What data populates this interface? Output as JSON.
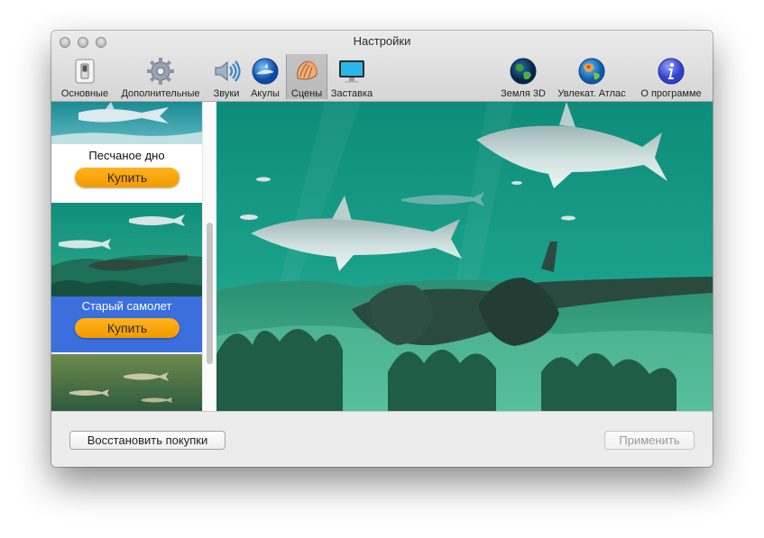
{
  "window": {
    "title": "Настройки"
  },
  "toolbar": {
    "items": [
      {
        "label": "Основные",
        "icon": "switch-icon"
      },
      {
        "label": "Дополнительные",
        "icon": "gear-icon"
      },
      {
        "label": "Звуки",
        "icon": "speaker-icon"
      },
      {
        "label": "Акулы",
        "icon": "shark-globe-icon"
      },
      {
        "label": "Сцены",
        "icon": "seashell-icon",
        "selected": true
      },
      {
        "label": "Заставка",
        "icon": "monitor-icon"
      },
      {
        "label": "Земля 3D",
        "icon": "earth-icon"
      },
      {
        "label": "Увлекат. Атлас",
        "icon": "atlas-globe-icon"
      },
      {
        "label": "О программе",
        "icon": "info-icon"
      }
    ]
  },
  "scenes": [
    {
      "name": "Песчаное дно",
      "buy_label": "Купить",
      "selected": false
    },
    {
      "name": "Старый самолет",
      "buy_label": "Купить",
      "selected": true
    }
  ],
  "footer": {
    "restore_label": "Восстановить покупки",
    "apply_label": "Применить",
    "apply_enabled": false
  },
  "colors": {
    "selection_blue": "#3b6fdd",
    "buy_orange": "#f7a30a",
    "water_teal": "#1a9a86"
  }
}
